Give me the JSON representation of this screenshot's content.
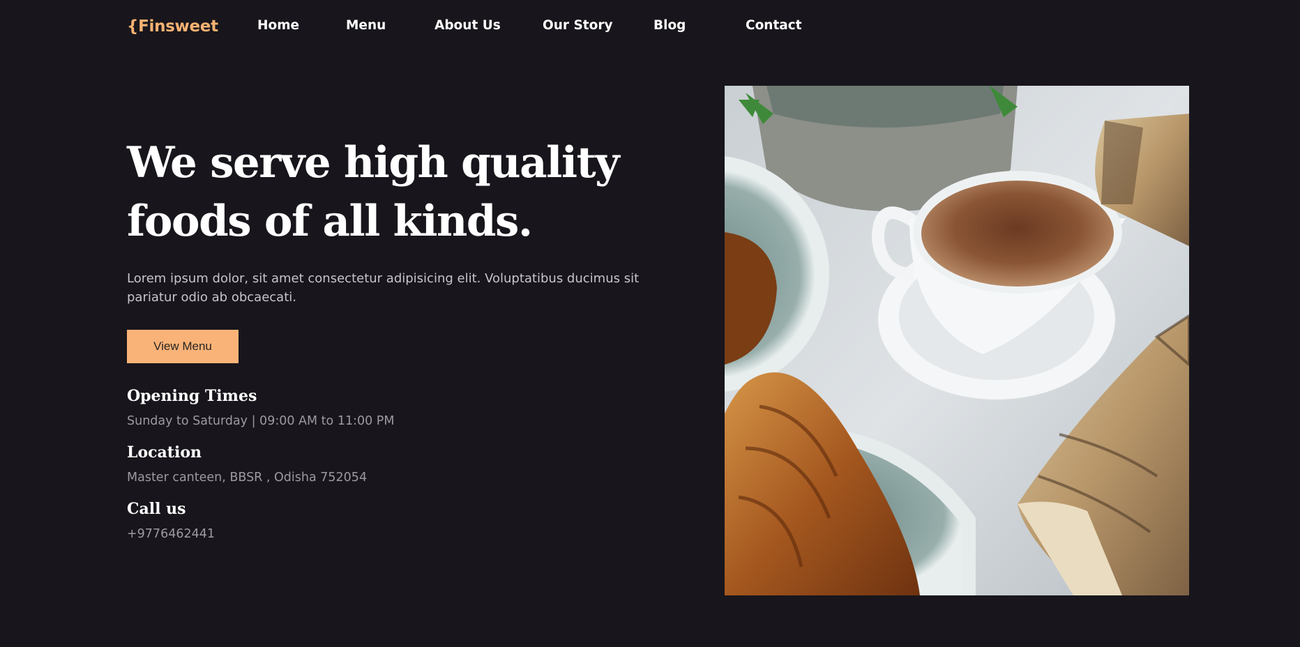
{
  "brand": {
    "logo": "{Finsweet"
  },
  "nav": {
    "items": [
      {
        "label": "Home"
      },
      {
        "label": "Menu"
      },
      {
        "label": "About Us"
      },
      {
        "label": "Our Story"
      },
      {
        "label": "Blog"
      },
      {
        "label": "Contact"
      }
    ]
  },
  "hero": {
    "title_line1": "We serve high quality",
    "title_line2": "foods of all kinds.",
    "description_line1": "Lorem ipsum dolor, sit amet consectetur adipisicing elit. Voluptatibus ducimus sit",
    "description_line2": "pariatur odio ab obcaecati.",
    "cta_label": "View Menu"
  },
  "info": {
    "opening_heading": "Opening Times",
    "opening_text": "Sunday to Saturday | 09:00 AM to 11:00 PM",
    "location_heading": "Location",
    "location_text": "Master canteen, BBSR , Odisha 752054",
    "call_heading": "Call us",
    "call_text": "+9776462441"
  },
  "colors": {
    "background": "#18161c",
    "accent": "#f9b378",
    "body_text": "#c7c4cc",
    "muted_text": "#9c99a2"
  }
}
